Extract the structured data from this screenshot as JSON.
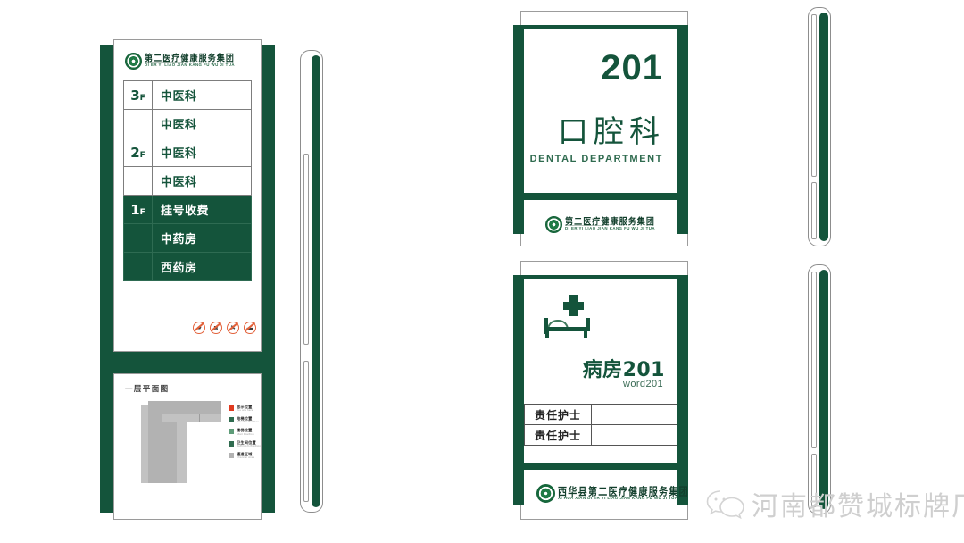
{
  "brand": {
    "cn_short": "第二医疗健康服务集团",
    "cn_short_prefix": "西华县",
    "py_short": "DI ER YI LIAO JIAN KANG FU WU JI TUA",
    "cn_full": "西华县第二医疗健康服务集团",
    "py_full": "XI HUA XIAN DI ER YI LIAO JIAN KANG FU WU JI TUA",
    "accent_green": "#14543b",
    "orange": "#e2613a"
  },
  "totem": {
    "directory": {
      "rows": [
        {
          "floor": "3",
          "suffix": "F",
          "name": "中医科",
          "dark": false
        },
        {
          "floor": "",
          "suffix": "",
          "name": "中医科",
          "dark": false
        },
        {
          "floor": "2",
          "suffix": "F",
          "name": "中医科",
          "dark": false
        },
        {
          "floor": "",
          "suffix": "",
          "name": "中医科",
          "dark": false
        },
        {
          "floor": "1",
          "suffix": "F",
          "name": "挂号收费",
          "dark": true
        },
        {
          "floor": "",
          "suffix": "",
          "name": "中药房",
          "dark": true
        },
        {
          "floor": "",
          "suffix": "",
          "name": "西药房",
          "dark": true
        }
      ]
    },
    "prohibition_icons": [
      {
        "name": "no-smoking-icon",
        "glyph": "🚬"
      },
      {
        "name": "no-photography-icon",
        "glyph": "📷"
      },
      {
        "name": "no-pets-icon",
        "glyph": "🐾"
      },
      {
        "name": "no-littering-icon",
        "glyph": "🗑"
      }
    ],
    "floorplan": {
      "title": "一层平面图",
      "legend": [
        {
          "cn": "您示位置",
          "en": "You are here",
          "color": "#e03a20"
        },
        {
          "cn": "电梯位置",
          "en": "Elevator Position",
          "color": "#2f6b4f"
        },
        {
          "cn": "楼梯位置",
          "en": "Stair Position",
          "color": "#5e9c78"
        },
        {
          "cn": "卫生间位置",
          "en": "Bathroom Position",
          "color": "#2f6b4f"
        },
        {
          "cn": "通道区域",
          "en": "Channel Area",
          "color": "#b2b2b2"
        }
      ]
    }
  },
  "dental_sign": {
    "room_number": "201",
    "name_cn": "口腔科",
    "name_en": "DENTAL DEPARTMENT"
  },
  "ward_sign": {
    "icon": "hospital-bed-icon",
    "name_cn": "病房201",
    "name_en": "word201",
    "rows": [
      {
        "label": "责任护士",
        "value": ""
      },
      {
        "label": "责任护士",
        "value": ""
      }
    ]
  },
  "wechat": {
    "icon": "wechat-icon",
    "label": "河南都赞城标牌厂"
  }
}
